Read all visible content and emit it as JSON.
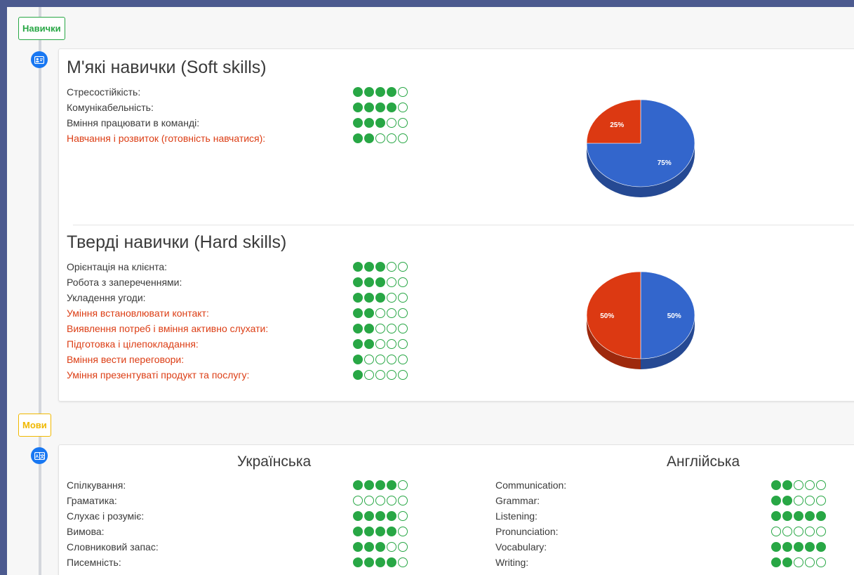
{
  "sections": {
    "skills_label": "Навички",
    "languages_label": "Мови"
  },
  "colors": {
    "dot_green": "#28a745",
    "needs_improvement_red": "#dc3d14",
    "pie_blue": "#3366cc",
    "pie_red": "#dc3912"
  },
  "soft_skills": {
    "title": "М'які навички (Soft skills)",
    "items": [
      {
        "name": "Стресостійкість:",
        "rating": 4,
        "highlight": false
      },
      {
        "name": "Комунікабельність:",
        "rating": 4,
        "highlight": false
      },
      {
        "name": "Вміння працювати в команді:",
        "rating": 3,
        "highlight": false
      },
      {
        "name": "Навчання і розвиток (готовність навчатися):",
        "rating": 2,
        "highlight": true
      }
    ],
    "chart_data": {
      "type": "pie",
      "slices": [
        {
          "label": "75%",
          "value": 75,
          "color": "#3366cc"
        },
        {
          "label": "25%",
          "value": 25,
          "color": "#dc3912"
        }
      ]
    }
  },
  "hard_skills": {
    "title": "Тверді навички (Hard skills)",
    "items": [
      {
        "name": "Орієнтація на клієнта:",
        "rating": 3,
        "highlight": false
      },
      {
        "name": "Робота з запереченнями:",
        "rating": 3,
        "highlight": false
      },
      {
        "name": "Укладення угоди:",
        "rating": 3,
        "highlight": false
      },
      {
        "name": "Уміння встановлювати контакт:",
        "rating": 2,
        "highlight": true
      },
      {
        "name": "Виявлення потреб і вміння активно слухати:",
        "rating": 2,
        "highlight": true
      },
      {
        "name": "Підготовка і цілепокладання:",
        "rating": 2,
        "highlight": true
      },
      {
        "name": "Вміння вести переговори:",
        "rating": 1,
        "highlight": true
      },
      {
        "name": "Уміння презентуваті продукт та послугу:",
        "rating": 1,
        "highlight": true
      }
    ],
    "chart_data": {
      "type": "pie",
      "slices": [
        {
          "label": "50%",
          "value": 50,
          "color": "#3366cc"
        },
        {
          "label": "50%",
          "value": 50,
          "color": "#dc3912"
        }
      ]
    }
  },
  "languages": {
    "ukrainian": {
      "title": "Українська",
      "items": [
        {
          "name": "Спілкування:",
          "rating": 4
        },
        {
          "name": "Граматика:",
          "rating": 0
        },
        {
          "name": "Слухає і розуміє:",
          "rating": 4
        },
        {
          "name": "Вимова:",
          "rating": 4
        },
        {
          "name": "Словниковий запас:",
          "rating": 3
        },
        {
          "name": "Писемність:",
          "rating": 4
        }
      ]
    },
    "english": {
      "title": "Англійська",
      "items": [
        {
          "name": "Communication:",
          "rating": 2
        },
        {
          "name": "Grammar:",
          "rating": 2
        },
        {
          "name": "Listening:",
          "rating": 5
        },
        {
          "name": "Pronunciation:",
          "rating": 0
        },
        {
          "name": "Vocabulary:",
          "rating": 5
        },
        {
          "name": "Writing:",
          "rating": 2
        }
      ]
    }
  }
}
